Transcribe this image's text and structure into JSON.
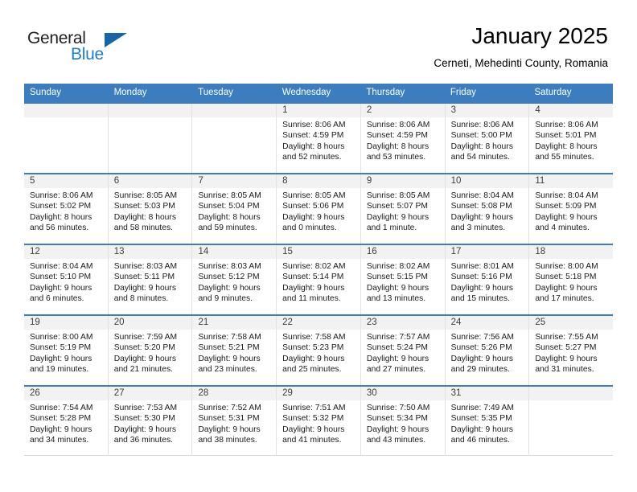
{
  "brand": {
    "name_dark": "General",
    "name_blue": "Blue",
    "accent_color": "#1c7fd0",
    "triangle_color": "#1565a8"
  },
  "header": {
    "title": "January 2025",
    "subtitle": "Cerneti, Mehedinti County, Romania"
  },
  "theme": {
    "header_bar_color": "#3b7dbf",
    "day_band_color": "#f2f2f2",
    "cell_border_color": "#e2e2e2"
  },
  "weekdays": [
    "Sunday",
    "Monday",
    "Tuesday",
    "Wednesday",
    "Thursday",
    "Friday",
    "Saturday"
  ],
  "labels": {
    "sunrise_prefix": "Sunrise:",
    "sunset_prefix": "Sunset:",
    "daylight_prefix": "Daylight:"
  },
  "weeks": [
    [
      {
        "day": "",
        "sunrise": "",
        "sunset": "",
        "daylight_line1": "",
        "daylight_line2": ""
      },
      {
        "day": "",
        "sunrise": "",
        "sunset": "",
        "daylight_line1": "",
        "daylight_line2": ""
      },
      {
        "day": "",
        "sunrise": "",
        "sunset": "",
        "daylight_line1": "",
        "daylight_line2": ""
      },
      {
        "day": "1",
        "sunrise": "Sunrise: 8:06 AM",
        "sunset": "Sunset: 4:59 PM",
        "daylight_line1": "Daylight: 8 hours",
        "daylight_line2": "and 52 minutes."
      },
      {
        "day": "2",
        "sunrise": "Sunrise: 8:06 AM",
        "sunset": "Sunset: 4:59 PM",
        "daylight_line1": "Daylight: 8 hours",
        "daylight_line2": "and 53 minutes."
      },
      {
        "day": "3",
        "sunrise": "Sunrise: 8:06 AM",
        "sunset": "Sunset: 5:00 PM",
        "daylight_line1": "Daylight: 8 hours",
        "daylight_line2": "and 54 minutes."
      },
      {
        "day": "4",
        "sunrise": "Sunrise: 8:06 AM",
        "sunset": "Sunset: 5:01 PM",
        "daylight_line1": "Daylight: 8 hours",
        "daylight_line2": "and 55 minutes."
      }
    ],
    [
      {
        "day": "5",
        "sunrise": "Sunrise: 8:06 AM",
        "sunset": "Sunset: 5:02 PM",
        "daylight_line1": "Daylight: 8 hours",
        "daylight_line2": "and 56 minutes."
      },
      {
        "day": "6",
        "sunrise": "Sunrise: 8:05 AM",
        "sunset": "Sunset: 5:03 PM",
        "daylight_line1": "Daylight: 8 hours",
        "daylight_line2": "and 58 minutes."
      },
      {
        "day": "7",
        "sunrise": "Sunrise: 8:05 AM",
        "sunset": "Sunset: 5:04 PM",
        "daylight_line1": "Daylight: 8 hours",
        "daylight_line2": "and 59 minutes."
      },
      {
        "day": "8",
        "sunrise": "Sunrise: 8:05 AM",
        "sunset": "Sunset: 5:06 PM",
        "daylight_line1": "Daylight: 9 hours",
        "daylight_line2": "and 0 minutes."
      },
      {
        "day": "9",
        "sunrise": "Sunrise: 8:05 AM",
        "sunset": "Sunset: 5:07 PM",
        "daylight_line1": "Daylight: 9 hours",
        "daylight_line2": "and 1 minute."
      },
      {
        "day": "10",
        "sunrise": "Sunrise: 8:04 AM",
        "sunset": "Sunset: 5:08 PM",
        "daylight_line1": "Daylight: 9 hours",
        "daylight_line2": "and 3 minutes."
      },
      {
        "day": "11",
        "sunrise": "Sunrise: 8:04 AM",
        "sunset": "Sunset: 5:09 PM",
        "daylight_line1": "Daylight: 9 hours",
        "daylight_line2": "and 4 minutes."
      }
    ],
    [
      {
        "day": "12",
        "sunrise": "Sunrise: 8:04 AM",
        "sunset": "Sunset: 5:10 PM",
        "daylight_line1": "Daylight: 9 hours",
        "daylight_line2": "and 6 minutes."
      },
      {
        "day": "13",
        "sunrise": "Sunrise: 8:03 AM",
        "sunset": "Sunset: 5:11 PM",
        "daylight_line1": "Daylight: 9 hours",
        "daylight_line2": "and 8 minutes."
      },
      {
        "day": "14",
        "sunrise": "Sunrise: 8:03 AM",
        "sunset": "Sunset: 5:12 PM",
        "daylight_line1": "Daylight: 9 hours",
        "daylight_line2": "and 9 minutes."
      },
      {
        "day": "15",
        "sunrise": "Sunrise: 8:02 AM",
        "sunset": "Sunset: 5:14 PM",
        "daylight_line1": "Daylight: 9 hours",
        "daylight_line2": "and 11 minutes."
      },
      {
        "day": "16",
        "sunrise": "Sunrise: 8:02 AM",
        "sunset": "Sunset: 5:15 PM",
        "daylight_line1": "Daylight: 9 hours",
        "daylight_line2": "and 13 minutes."
      },
      {
        "day": "17",
        "sunrise": "Sunrise: 8:01 AM",
        "sunset": "Sunset: 5:16 PM",
        "daylight_line1": "Daylight: 9 hours",
        "daylight_line2": "and 15 minutes."
      },
      {
        "day": "18",
        "sunrise": "Sunrise: 8:00 AM",
        "sunset": "Sunset: 5:18 PM",
        "daylight_line1": "Daylight: 9 hours",
        "daylight_line2": "and 17 minutes."
      }
    ],
    [
      {
        "day": "19",
        "sunrise": "Sunrise: 8:00 AM",
        "sunset": "Sunset: 5:19 PM",
        "daylight_line1": "Daylight: 9 hours",
        "daylight_line2": "and 19 minutes."
      },
      {
        "day": "20",
        "sunrise": "Sunrise: 7:59 AM",
        "sunset": "Sunset: 5:20 PM",
        "daylight_line1": "Daylight: 9 hours",
        "daylight_line2": "and 21 minutes."
      },
      {
        "day": "21",
        "sunrise": "Sunrise: 7:58 AM",
        "sunset": "Sunset: 5:21 PM",
        "daylight_line1": "Daylight: 9 hours",
        "daylight_line2": "and 23 minutes."
      },
      {
        "day": "22",
        "sunrise": "Sunrise: 7:58 AM",
        "sunset": "Sunset: 5:23 PM",
        "daylight_line1": "Daylight: 9 hours",
        "daylight_line2": "and 25 minutes."
      },
      {
        "day": "23",
        "sunrise": "Sunrise: 7:57 AM",
        "sunset": "Sunset: 5:24 PM",
        "daylight_line1": "Daylight: 9 hours",
        "daylight_line2": "and 27 minutes."
      },
      {
        "day": "24",
        "sunrise": "Sunrise: 7:56 AM",
        "sunset": "Sunset: 5:26 PM",
        "daylight_line1": "Daylight: 9 hours",
        "daylight_line2": "and 29 minutes."
      },
      {
        "day": "25",
        "sunrise": "Sunrise: 7:55 AM",
        "sunset": "Sunset: 5:27 PM",
        "daylight_line1": "Daylight: 9 hours",
        "daylight_line2": "and 31 minutes."
      }
    ],
    [
      {
        "day": "26",
        "sunrise": "Sunrise: 7:54 AM",
        "sunset": "Sunset: 5:28 PM",
        "daylight_line1": "Daylight: 9 hours",
        "daylight_line2": "and 34 minutes."
      },
      {
        "day": "27",
        "sunrise": "Sunrise: 7:53 AM",
        "sunset": "Sunset: 5:30 PM",
        "daylight_line1": "Daylight: 9 hours",
        "daylight_line2": "and 36 minutes."
      },
      {
        "day": "28",
        "sunrise": "Sunrise: 7:52 AM",
        "sunset": "Sunset: 5:31 PM",
        "daylight_line1": "Daylight: 9 hours",
        "daylight_line2": "and 38 minutes."
      },
      {
        "day": "29",
        "sunrise": "Sunrise: 7:51 AM",
        "sunset": "Sunset: 5:32 PM",
        "daylight_line1": "Daylight: 9 hours",
        "daylight_line2": "and 41 minutes."
      },
      {
        "day": "30",
        "sunrise": "Sunrise: 7:50 AM",
        "sunset": "Sunset: 5:34 PM",
        "daylight_line1": "Daylight: 9 hours",
        "daylight_line2": "and 43 minutes."
      },
      {
        "day": "31",
        "sunrise": "Sunrise: 7:49 AM",
        "sunset": "Sunset: 5:35 PM",
        "daylight_line1": "Daylight: 9 hours",
        "daylight_line2": "and 46 minutes."
      },
      {
        "day": "",
        "sunrise": "",
        "sunset": "",
        "daylight_line1": "",
        "daylight_line2": ""
      }
    ]
  ]
}
